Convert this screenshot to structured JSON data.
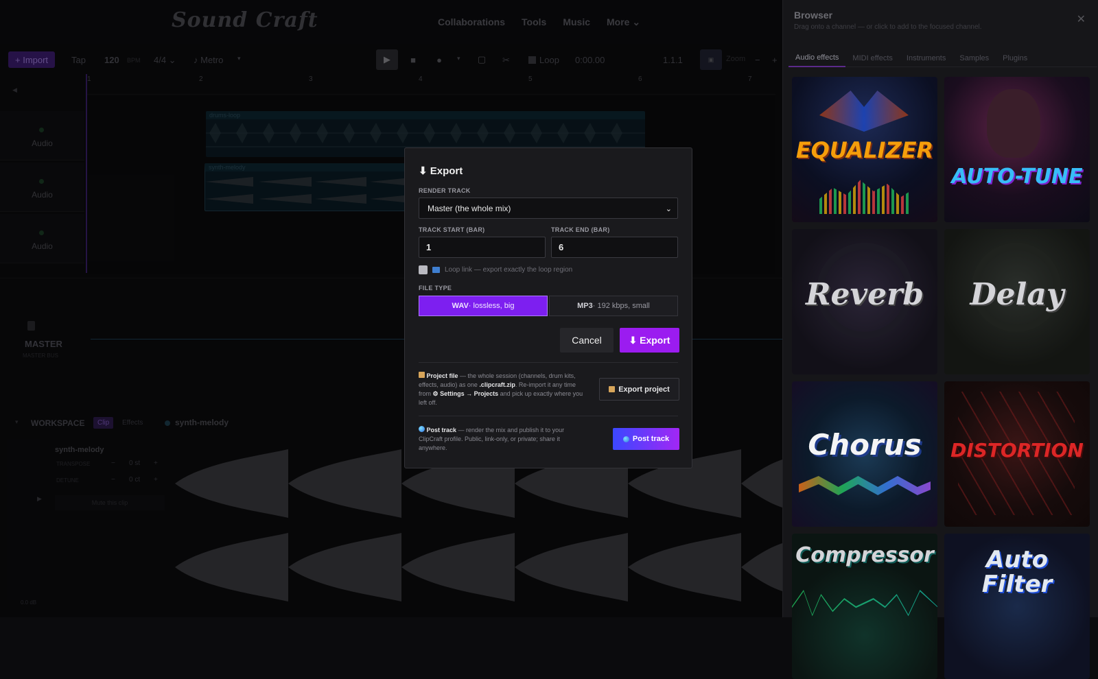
{
  "app": {
    "logo": "Sound Craft"
  },
  "nav": {
    "links": [
      "Collaborations",
      "Tools",
      "Music",
      "More ⌄"
    ]
  },
  "transport": {
    "import": "+ Import",
    "tap": "Tap",
    "bpm": "120",
    "bpm_unit": "BPM",
    "time_sig": "4/4 ⌄",
    "metro": "♪ Metro",
    "loop": "Loop",
    "time": "0:00.00",
    "position": "1.1.1",
    "zoom": "Zoom"
  },
  "ruler": {
    "bars": [
      "1",
      "2",
      "3",
      "4",
      "5",
      "6",
      "7"
    ]
  },
  "tracks": [
    {
      "label": "Audio"
    },
    {
      "label": "Audio"
    },
    {
      "label": "Audio"
    }
  ],
  "clips": {
    "drums": "drums-loop",
    "synth": "synth-melody"
  },
  "master": {
    "title": "MASTER",
    "subtitle": "MASTER BUS"
  },
  "workspace": {
    "title": "WORKSPACE",
    "tab_clip": "Clip",
    "tab_effects": "Effects",
    "clip_name": "synth-melody",
    "panel_name": "synth-melody",
    "transpose_label": "TRANSPOSE",
    "transpose_value": "0 st",
    "detune_label": "DETUNE",
    "detune_value": "0 ct",
    "mute": "Mute this clip",
    "db": "0.0 dB"
  },
  "browser": {
    "title": "Browser",
    "subtitle": "Drag onto a channel — or click to add to the focused channel.",
    "tabs": [
      "Audio effects",
      "MIDI effects",
      "Instruments",
      "Samples",
      "Plugins"
    ],
    "active_tab": 0,
    "tiles": [
      "EQUALIZER",
      "AUTO-TUNE",
      "Reverb",
      "Delay",
      "Chorus",
      "DISTORTION",
      "Compressor",
      "Auto Filter"
    ]
  },
  "modal": {
    "title": "⬇ Export",
    "render_label": "RENDER TRACK",
    "render_value": "Master (the whole mix)",
    "start_label": "TRACK START (BAR)",
    "start_value": "1",
    "end_label": "TRACK END (BAR)",
    "end_value": "6",
    "loop_link": "Loop link — export exactly the loop region",
    "filetype_label": "FILE TYPE",
    "wav_bold": "WAV",
    "wav_rest": " · lossless, big",
    "mp3_bold": "MP3",
    "mp3_rest": " · 192 kbps, small",
    "cancel": "Cancel",
    "export": "⬇ Export",
    "project_title": "Project file",
    "project_text_1": " — the whole session (channels, drum kits, effects, audio) as one ",
    "project_file": ".clipcraft.zip",
    "project_text_2": ". Re-import it any time from ",
    "project_settings": "⚙ Settings → Projects",
    "project_text_3": " and pick up exactly where you left off.",
    "export_project": "Export project",
    "post_title": "Post track",
    "post_text": " — render the mix and publish it to your ClipCraft profile. Public, link-only, or private; share it anywhere.",
    "post_button": "Post track"
  },
  "colors": {
    "accent": "#9b1cf0",
    "wav_selected": "#7d1ff0",
    "post_from": "#3b48ff",
    "post_to": "#a227f5"
  }
}
